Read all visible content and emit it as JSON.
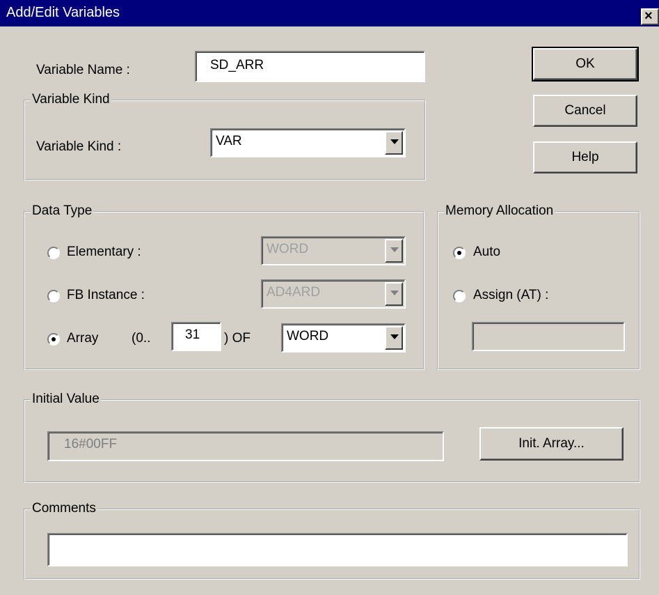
{
  "window": {
    "title": "Add/Edit Variables",
    "close_glyph": "×"
  },
  "variable_name": {
    "label": "Variable Name :",
    "value": "SD_ARR"
  },
  "buttons": {
    "ok": "OK",
    "cancel": "Cancel",
    "help": "Help",
    "init_array": "Init. Array..."
  },
  "variable_kind": {
    "group_label": "Variable Kind",
    "label": "Variable Kind :",
    "value": "VAR"
  },
  "data_type": {
    "group_label": "Data Type",
    "elementary": {
      "label": "Elementary :",
      "value": "WORD",
      "checked": false,
      "enabled": false
    },
    "fb_instance": {
      "label": "FB Instance :",
      "value": "AD4ARD",
      "checked": false,
      "enabled": false
    },
    "array": {
      "label": "Array",
      "range_start": "(0..",
      "upper_bound": "31",
      "of_label": ") OF",
      "value": "WORD",
      "checked": true
    }
  },
  "memory_allocation": {
    "group_label": "Memory Allocation",
    "auto": {
      "label": "Auto",
      "checked": true
    },
    "assign": {
      "label": "Assign (AT) :",
      "checked": false,
      "value": ""
    }
  },
  "initial_value": {
    "group_label": "Initial Value",
    "value": "16#00FF"
  },
  "comments": {
    "group_label": "Comments",
    "value": ""
  },
  "colors": {
    "titlebar": "#00007c",
    "face": "#d4d0c8"
  }
}
